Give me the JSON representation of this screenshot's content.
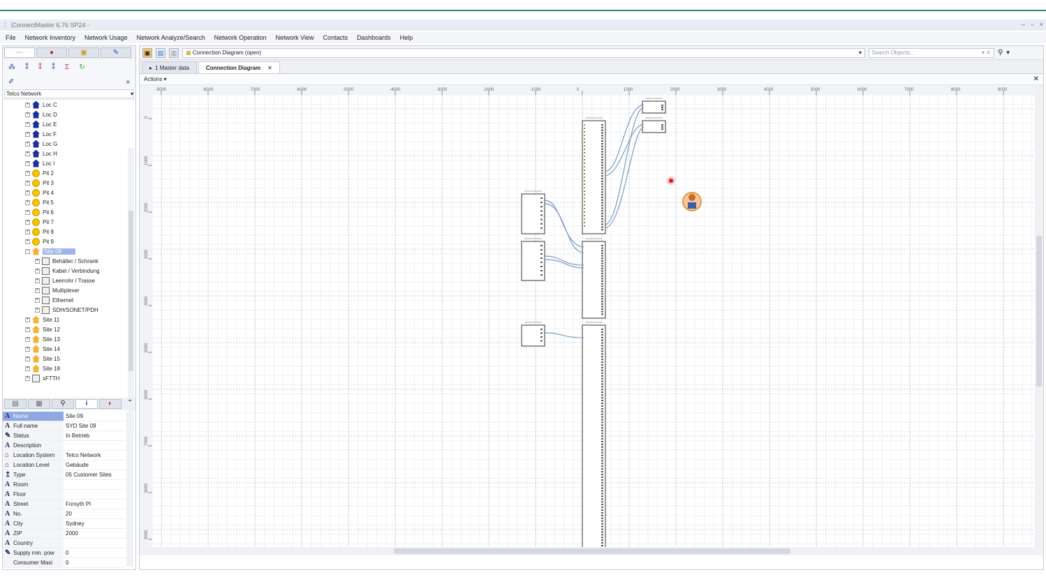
{
  "window": {
    "title": "ConnectMaster 6.76 SP24 - ",
    "controls": [
      "–",
      "▫",
      "×"
    ]
  },
  "menu": [
    "File",
    "Network Inventory",
    "Network Usage",
    "Network Analyze/Search",
    "Network Operation",
    "Network View",
    "Contacts",
    "Dashboards",
    "Help"
  ],
  "left": {
    "network_select": "Telco Network",
    "tree": [
      {
        "label": "Loc C",
        "type": "loc",
        "level": 0
      },
      {
        "label": "Loc D",
        "type": "loc",
        "level": 0
      },
      {
        "label": "Loc E",
        "type": "loc",
        "level": 0
      },
      {
        "label": "Loc F",
        "type": "loc",
        "level": 0
      },
      {
        "label": "Loc G",
        "type": "loc",
        "level": 0
      },
      {
        "label": "Loc H",
        "type": "loc",
        "level": 0
      },
      {
        "label": "Loc I",
        "type": "loc",
        "level": 0
      },
      {
        "label": "Pit 2",
        "type": "pit",
        "level": 0
      },
      {
        "label": "Pit 3",
        "type": "pit",
        "level": 0
      },
      {
        "label": "Pit 4",
        "type": "pit",
        "level": 0
      },
      {
        "label": "Pit 5",
        "type": "pit",
        "level": 0
      },
      {
        "label": "Pit 6",
        "type": "pit",
        "level": 0
      },
      {
        "label": "Pit 7",
        "type": "pit",
        "level": 0
      },
      {
        "label": "Pit 8",
        "type": "pit",
        "level": 0
      },
      {
        "label": "Pit 9",
        "type": "pit",
        "level": 0
      },
      {
        "label": "Site 09",
        "type": "site",
        "level": 0,
        "selected": true,
        "expanded": true
      },
      {
        "label": "Behälter / Schrank",
        "type": "gen",
        "level": 1
      },
      {
        "label": "Kabel / Verbindung",
        "type": "gen",
        "level": 1
      },
      {
        "label": "Leerrohr / Trasse",
        "type": "gen",
        "level": 1
      },
      {
        "label": "Multiplexer",
        "type": "gen",
        "level": 1
      },
      {
        "label": "Ethernet",
        "type": "gen",
        "level": 1
      },
      {
        "label": "SDH/SONET/PDH",
        "type": "gen",
        "level": 1
      },
      {
        "label": "Site 11",
        "type": "site",
        "level": 0
      },
      {
        "label": "Site 12",
        "type": "site",
        "level": 0
      },
      {
        "label": "Site 13",
        "type": "site",
        "level": 0
      },
      {
        "label": "Site 14",
        "type": "site",
        "level": 0
      },
      {
        "label": "Site 15",
        "type": "site",
        "level": 0
      },
      {
        "label": "Site 18",
        "type": "site",
        "level": 0
      },
      {
        "label": "xFTTH",
        "type": "gen",
        "level": 0
      }
    ],
    "properties": [
      {
        "key": "Name",
        "value": "Site 09",
        "icon": "A",
        "selected": true
      },
      {
        "key": "Full name",
        "value": "SYD Site 09",
        "icon": "A"
      },
      {
        "key": "Status",
        "value": "In Betrieb",
        "icon": "✎"
      },
      {
        "key": "Description",
        "value": "",
        "icon": "A"
      },
      {
        "key": "Location System",
        "value": "Telco Network",
        "icon": "⌂"
      },
      {
        "key": "Location Level",
        "value": "Gebäude",
        "icon": "⌂"
      },
      {
        "key": "Type",
        "value": "05 Customer Sites",
        "icon": "↥"
      },
      {
        "key": "Room",
        "value": "",
        "icon": "A"
      },
      {
        "key": "Floor",
        "value": "",
        "icon": "A"
      },
      {
        "key": "Street",
        "value": "Forsyth Pl",
        "icon": "A"
      },
      {
        "key": "No.",
        "value": "20",
        "icon": "A"
      },
      {
        "key": "City",
        "value": "Sydney",
        "icon": "A"
      },
      {
        "key": "ZIP",
        "value": "2000",
        "icon": "A"
      },
      {
        "key": "Country",
        "value": "",
        "icon": "A"
      },
      {
        "key": "Supply min. pow",
        "value": "0",
        "icon": "✎"
      },
      {
        "key": "Consumer Maxi",
        "value": "0",
        "icon": ""
      }
    ]
  },
  "main": {
    "diagram_select": "Connection Diagram  (open)",
    "search_placeholder": "Search Objects...",
    "tabs": [
      {
        "label": "1 Master data",
        "active": false
      },
      {
        "label": "Connection Diagram",
        "active": true
      }
    ],
    "actions_label": "Actions ▾",
    "ruler_x": [
      "-9000",
      "-8000",
      "-7000",
      "-6000",
      "-5000",
      "-4000",
      "-3000",
      "-2000",
      "-1000",
      "0",
      "1000",
      "2000",
      "3000",
      "4000",
      "5000",
      "6000",
      "7000",
      "8000",
      "9000"
    ],
    "ruler_y": [
      "0",
      "1000",
      "2000",
      "3000",
      "4000",
      "5000",
      "6000",
      "7000",
      "8000",
      "9000"
    ]
  }
}
